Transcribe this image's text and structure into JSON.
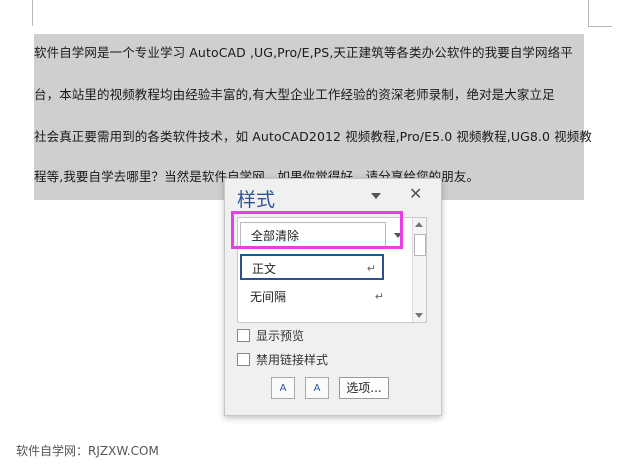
{
  "document": {
    "lines": [
      "软件自学网是一个专业学习 AutoCAD ,UG,Pro/E,PS,天正建筑等各类办公软件的我要自学网络平",
      "台，本站里的视频教程均由经验丰富的,有大型企业工作经验的资深老师录制，绝对是大家立足",
      "社会真正要需用到的各类软件技术，如 AutoCAD2012 视频教程,Pro/E5.0 视频教程,UG8.0 视频教",
      "程等,我要自学去哪里？当然是软件自学网，如果你觉得好，请分享给您的朋友。"
    ]
  },
  "styles_pane": {
    "title": "样式",
    "close_glyph": "✕",
    "items": [
      {
        "label": "全部清除",
        "mark": ""
      },
      {
        "label": "正文",
        "mark": "↵"
      },
      {
        "label": "无间隔",
        "mark": "↵"
      }
    ],
    "show_preview_label": "显示预览",
    "disable_linked_label": "禁用链接样式",
    "options_button": "选项...",
    "new_style_icon_text": "A",
    "inspector_icon_text": "A"
  },
  "watermark": "软件自学网：RJZXW.COM",
  "colors": {
    "title_blue": "#2b579a",
    "highlight_magenta": "#e83ee8",
    "selected_border": "#2f4f8f",
    "selection_gray": "#cfcfcf"
  }
}
